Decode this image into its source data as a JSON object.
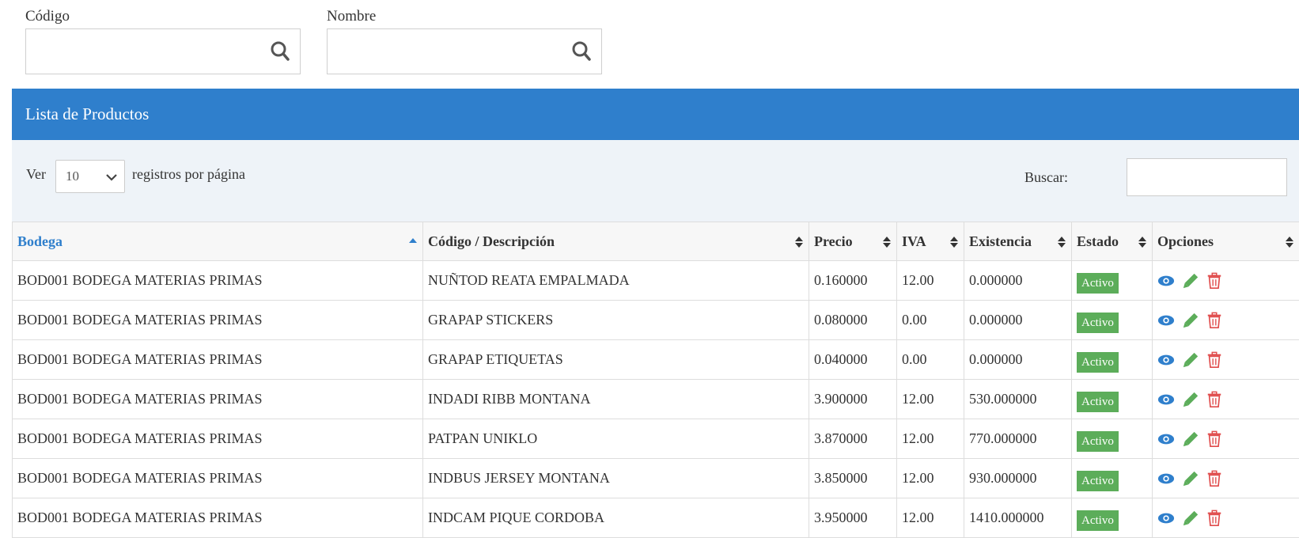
{
  "filters": {
    "codigo_label": "Código",
    "codigo_value": "",
    "nombre_label": "Nombre",
    "nombre_value": ""
  },
  "panel": {
    "title": "Lista de Productos"
  },
  "controls": {
    "ver_label": "Ver",
    "page_length": "10",
    "per_page_label": "registros por página",
    "buscar_label": "Buscar:",
    "buscar_value": ""
  },
  "table": {
    "headers": {
      "bodega": "Bodega",
      "codigo": "Código / Descripción",
      "precio": "Precio",
      "iva": "IVA",
      "existencia": "Existencia",
      "estado": "Estado",
      "opciones": "Opciones"
    },
    "rows": [
      {
        "bodega": "BOD001 BODEGA MATERIAS PRIMAS",
        "codigo": "NUÑTOD REATA EMPALMADA",
        "precio": "0.160000",
        "iva": "12.00",
        "existencia": "0.000000",
        "estado": "Activo"
      },
      {
        "bodega": "BOD001 BODEGA MATERIAS PRIMAS",
        "codigo": "GRAPAP STICKERS",
        "precio": "0.080000",
        "iva": "0.00",
        "existencia": "0.000000",
        "estado": "Activo"
      },
      {
        "bodega": "BOD001 BODEGA MATERIAS PRIMAS",
        "codigo": "GRAPAP ETIQUETAS",
        "precio": "0.040000",
        "iva": "0.00",
        "existencia": "0.000000",
        "estado": "Activo"
      },
      {
        "bodega": "BOD001 BODEGA MATERIAS PRIMAS",
        "codigo": "INDADI RIBB MONTANA",
        "precio": "3.900000",
        "iva": "12.00",
        "existencia": "530.000000",
        "estado": "Activo"
      },
      {
        "bodega": "BOD001 BODEGA MATERIAS PRIMAS",
        "codigo": "PATPAN UNIKLO",
        "precio": "3.870000",
        "iva": "12.00",
        "existencia": "770.000000",
        "estado": "Activo"
      },
      {
        "bodega": "BOD001 BODEGA MATERIAS PRIMAS",
        "codigo": "INDBUS JERSEY MONTANA",
        "precio": "3.850000",
        "iva": "12.00",
        "existencia": "930.000000",
        "estado": "Activo"
      },
      {
        "bodega": "BOD001 BODEGA MATERIAS PRIMAS",
        "codigo": "INDCAM PIQUE CORDOBA",
        "precio": "3.950000",
        "iva": "12.00",
        "existencia": "1410.000000",
        "estado": "Activo"
      }
    ]
  },
  "colors": {
    "header_blue": "#2f7fcc",
    "active_green": "#5cad5a",
    "view_icon": "#2f7fcc",
    "edit_icon": "#5cad5a",
    "delete_icon": "#e04b4b"
  }
}
